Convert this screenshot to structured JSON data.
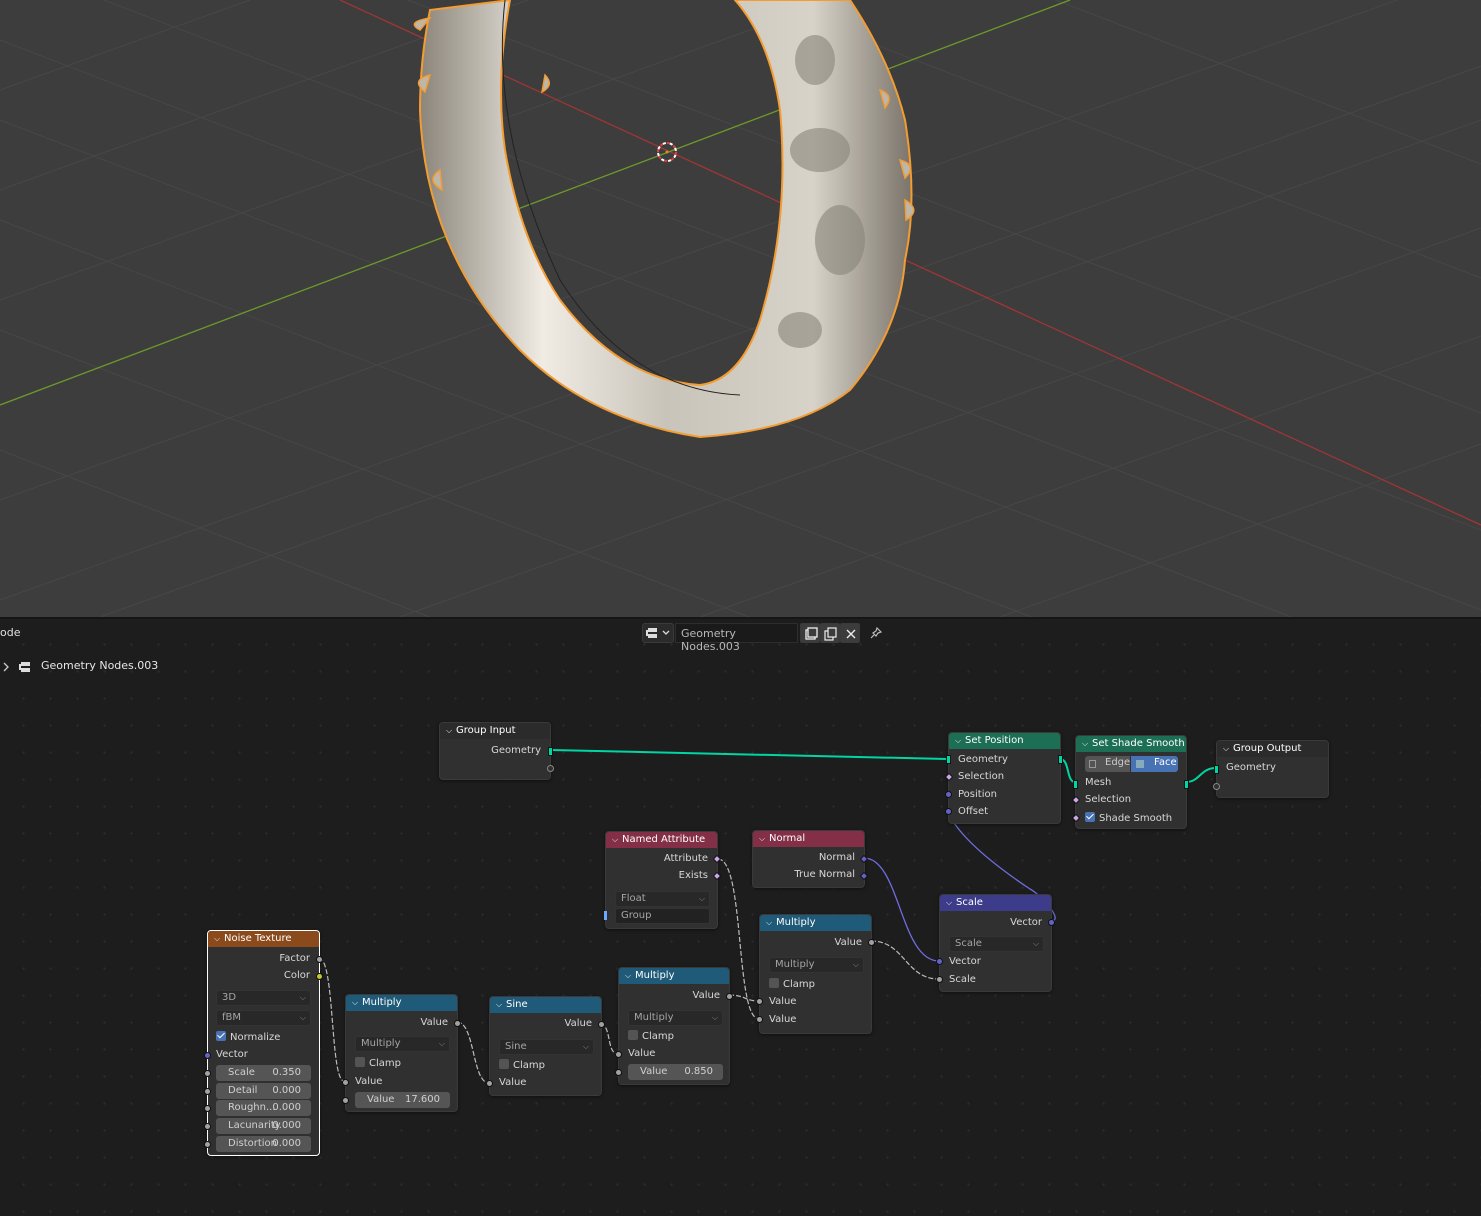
{
  "colors": {
    "viewport_bg": "#3d3d3d",
    "editor_bg": "#1d1d1d",
    "selection_outline": "#f39c32",
    "x_axis": "#a03535",
    "y_axis": "#6e9a2a",
    "geometry_socket": "#00d6a3",
    "vector_socket": "#6363c7",
    "float_socket": "#a1a1a1",
    "color_socket": "#c7c729",
    "header_texture": "#8a4a1c",
    "header_math": "#1f5a78",
    "header_geometry": "#1c6e55",
    "header_input": "#842f48",
    "header_vector": "#3c3c8a",
    "header_group": "#2b2b2b"
  },
  "editor_header": {
    "mode_label": "ode",
    "node_tree_name": "Geometry Nodes.003",
    "icons": [
      "node-tree-icon",
      "chevron-down-icon",
      "fake-user-icon",
      "duplicate-icon",
      "close-icon",
      "pin-icon"
    ]
  },
  "breadcrumb": {
    "label": "Geometry Nodes.003",
    "icons": [
      "chevron-right-icon",
      "node-tree-icon"
    ]
  },
  "nodes": {
    "group_input": {
      "title": "Group Input",
      "out_geometry": "Geometry"
    },
    "set_position": {
      "title": "Set Position",
      "geometry": "Geometry",
      "selection": "Selection",
      "position": "Position",
      "offset": "Offset"
    },
    "set_shade_smooth": {
      "title": "Set Shade Smooth",
      "opt_edge": "Edge",
      "opt_face": "Face",
      "mesh": "Mesh",
      "selection": "Selection",
      "shade_smooth": "Shade Smooth",
      "shade_smooth_checked": true
    },
    "group_output": {
      "title": "Group Output",
      "geometry": "Geometry"
    },
    "named_attribute": {
      "title": "Named Attribute",
      "attribute": "Attribute",
      "exists": "Exists",
      "type": "Float",
      "name_placeholder": "Group"
    },
    "normal": {
      "title": "Normal",
      "normal": "Normal",
      "true_normal": "True Normal"
    },
    "scale": {
      "title": "Scale",
      "vector_out": "Vector",
      "mode": "Scale",
      "vector_in": "Vector",
      "scale_in": "Scale"
    },
    "multiply_3": {
      "title": "Multiply",
      "value_out": "Value",
      "operation": "Multiply",
      "clamp": "Clamp",
      "value_a": "Value",
      "value_b": "Value"
    },
    "multiply_2": {
      "title": "Multiply",
      "value_out": "Value",
      "operation": "Multiply",
      "clamp": "Clamp",
      "value_a": "Value",
      "value_b_label": "Value",
      "value_b": "0.850"
    },
    "sine": {
      "title": "Sine",
      "value_out": "Value",
      "operation": "Sine",
      "clamp": "Clamp",
      "value_in": "Value"
    },
    "multiply_1": {
      "title": "Multiply",
      "value_out": "Value",
      "operation": "Multiply",
      "clamp": "Clamp",
      "value_a": "Value",
      "value_b_label": "Value",
      "value_b": "17.600"
    },
    "noise_texture": {
      "title": "Noise Texture",
      "factor": "Factor",
      "color": "Color",
      "dimensions": "3D",
      "type": "fBM",
      "normalize": "Normalize",
      "normalize_checked": true,
      "vector": "Vector",
      "fields": [
        {
          "label": "Scale",
          "value": "0.350"
        },
        {
          "label": "Detail",
          "value": "0.000"
        },
        {
          "label": "Roughn...",
          "value": "0.000"
        },
        {
          "label": "Lacunarity",
          "value": "0.000"
        },
        {
          "label": "Distortion",
          "value": "0.000"
        }
      ]
    }
  }
}
